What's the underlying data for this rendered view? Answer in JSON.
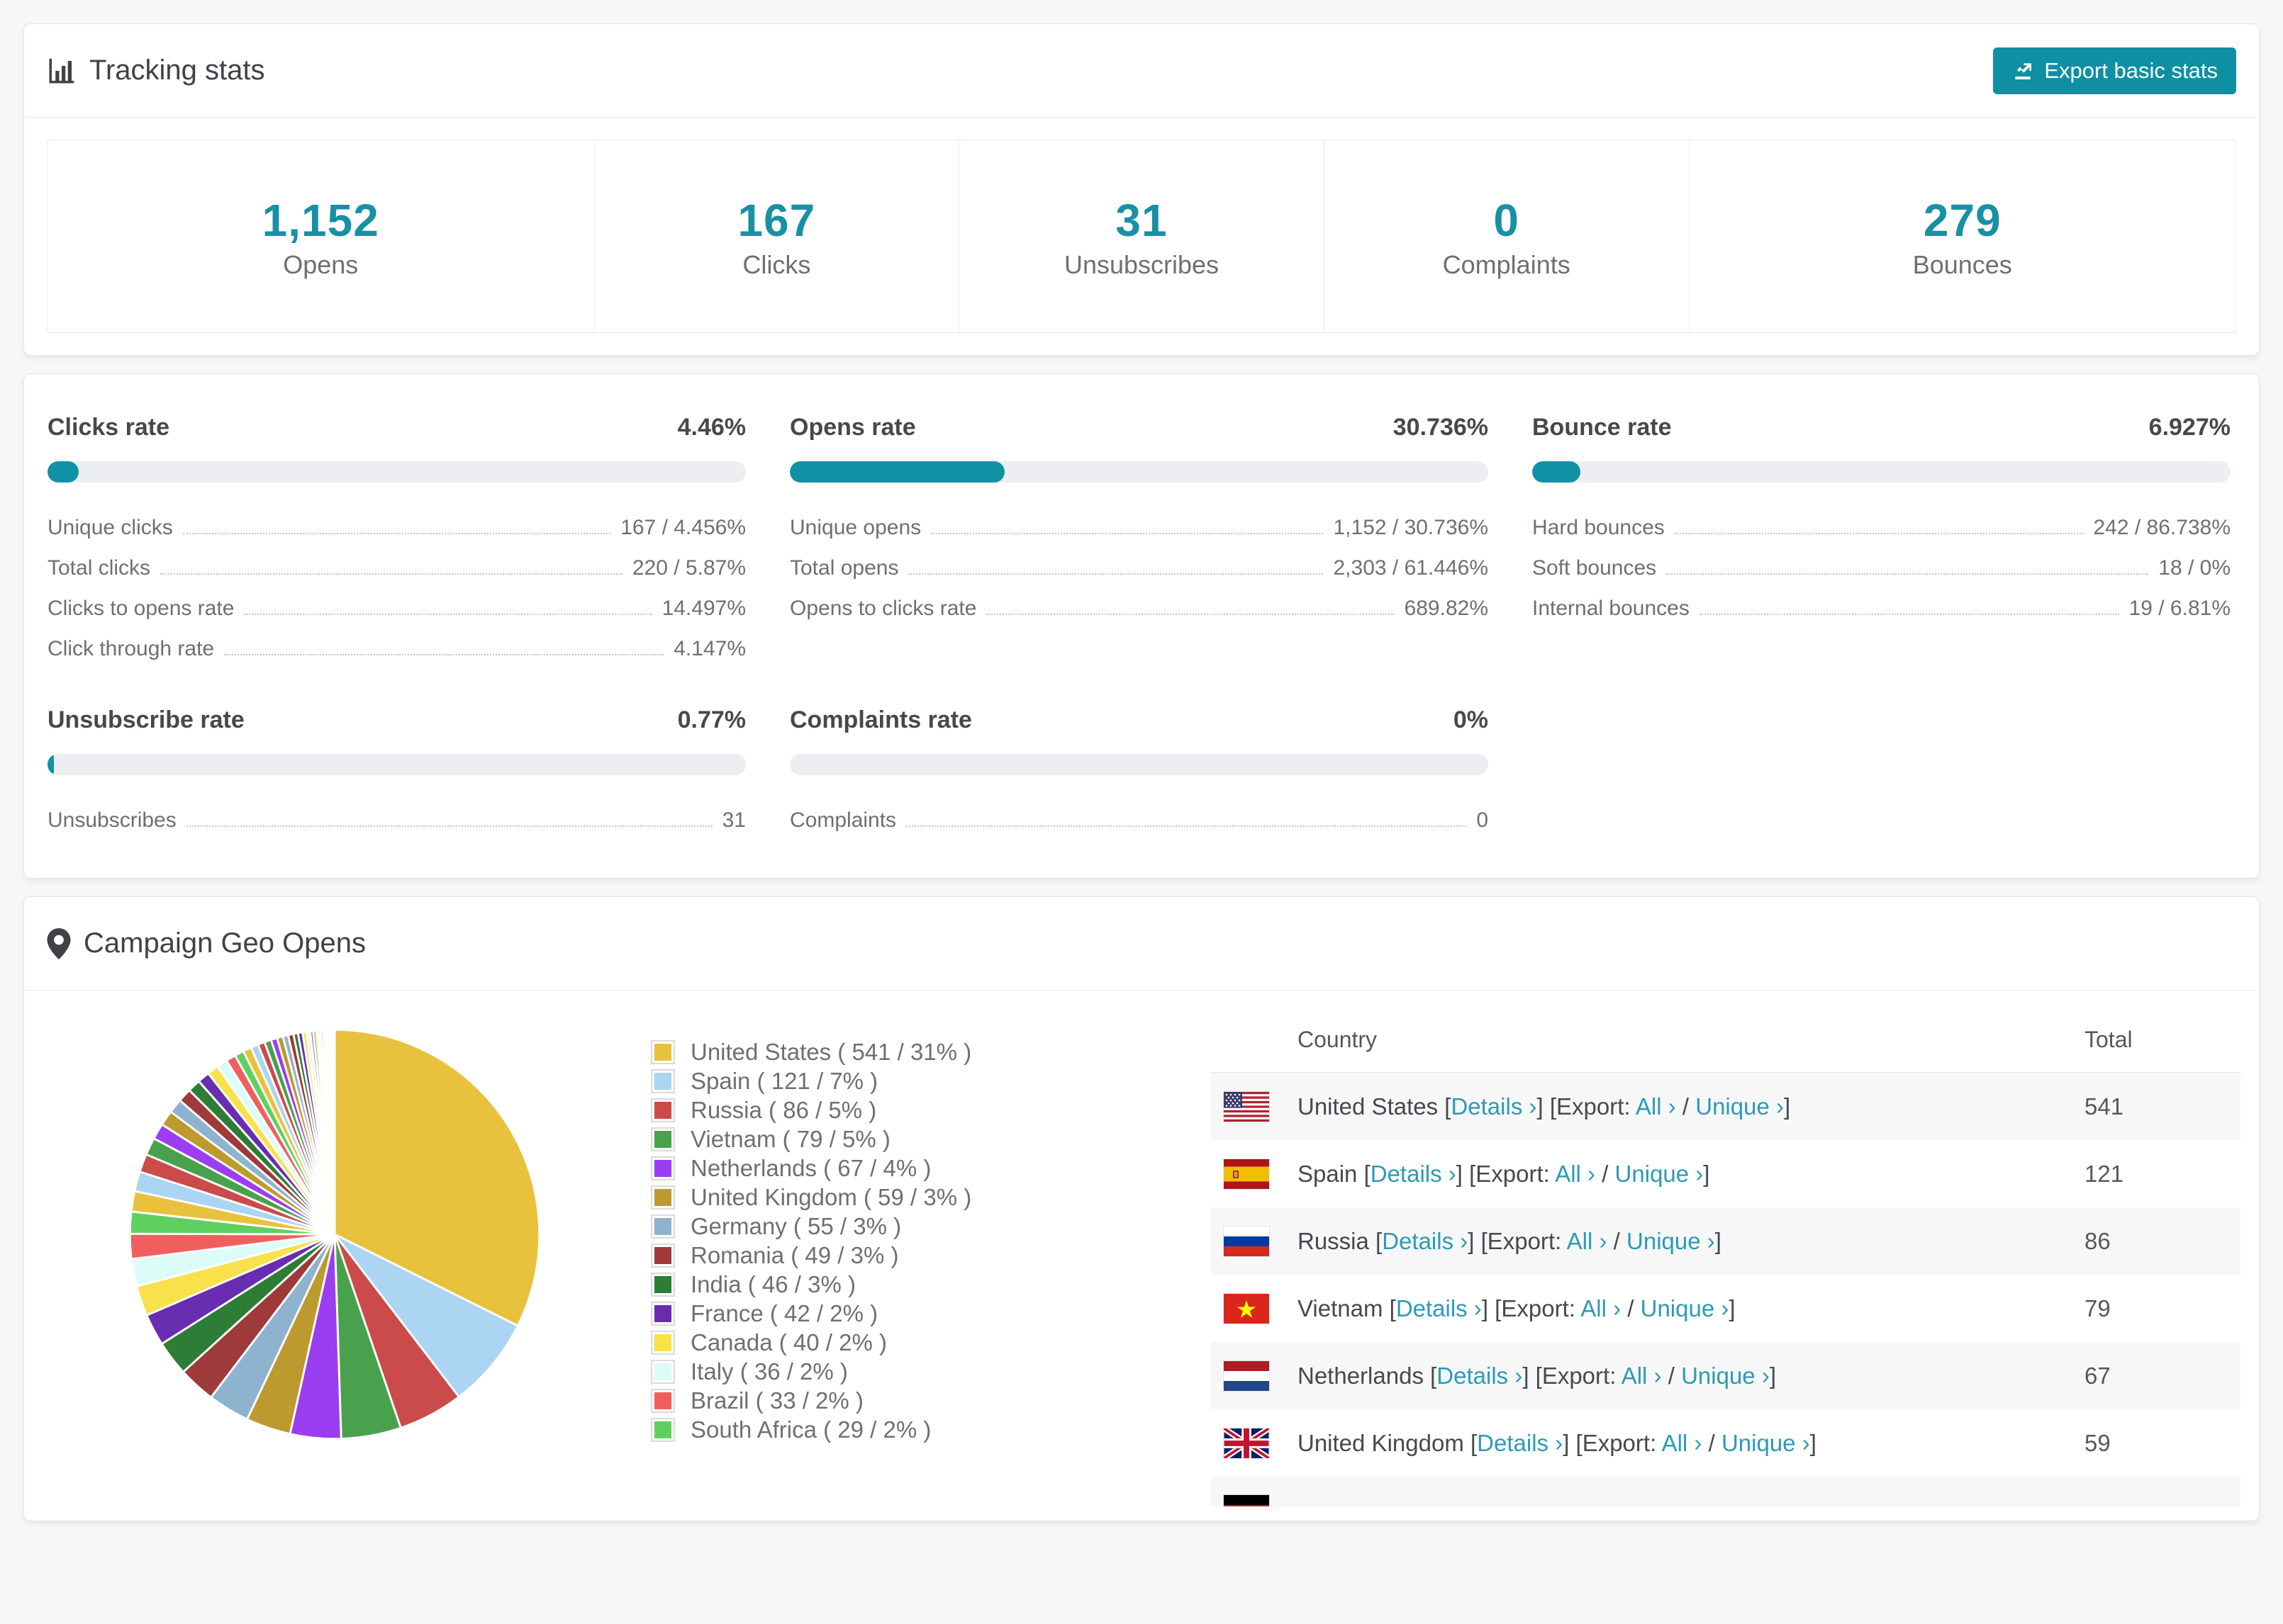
{
  "colors": {
    "accent": "#1791a5",
    "button": "#0e8fa4",
    "link": "#2d9ab8",
    "bar_track": "#eceef1",
    "row_stripe": "#f7f7f8"
  },
  "tracking": {
    "title": "Tracking stats",
    "export_button": "Export basic stats",
    "stats": [
      {
        "value": "1,152",
        "label": "Opens"
      },
      {
        "value": "167",
        "label": "Clicks"
      },
      {
        "value": "31",
        "label": "Unsubscribes"
      },
      {
        "value": "0",
        "label": "Complaints"
      },
      {
        "value": "279",
        "label": "Bounces"
      }
    ]
  },
  "rates": [
    {
      "title": "Clicks rate",
      "value": "4.46%",
      "bar_pct": 4.46,
      "rows": [
        {
          "label": "Unique clicks",
          "value": "167 / 4.456%"
        },
        {
          "label": "Total clicks",
          "value": "220 / 5.87%"
        },
        {
          "label": "Clicks to opens rate",
          "value": "14.497%"
        },
        {
          "label": "Click through rate",
          "value": "4.147%"
        }
      ]
    },
    {
      "title": "Opens rate",
      "value": "30.736%",
      "bar_pct": 30.736,
      "rows": [
        {
          "label": "Unique opens",
          "value": "1,152 / 30.736%"
        },
        {
          "label": "Total opens",
          "value": "2,303 / 61.446%"
        },
        {
          "label": "Opens to clicks rate",
          "value": "689.82%"
        }
      ]
    },
    {
      "title": "Bounce rate",
      "value": "6.927%",
      "bar_pct": 6.927,
      "rows": [
        {
          "label": "Hard bounces",
          "value": "242 / 86.738%"
        },
        {
          "label": "Soft bounces",
          "value": "18 / 0%"
        },
        {
          "label": "Internal bounces",
          "value": "19 / 6.81%"
        }
      ]
    },
    {
      "title": "Unsubscribe rate",
      "value": "0.77%",
      "bar_pct": 0.77,
      "rows": [
        {
          "label": "Unsubscribes",
          "value": "31"
        }
      ]
    },
    {
      "title": "Complaints rate",
      "value": "0%",
      "bar_pct": 0,
      "rows": [
        {
          "label": "Complaints",
          "value": "0"
        }
      ]
    }
  ],
  "geo": {
    "title": "Campaign Geo Opens",
    "links": {
      "details": "Details",
      "export": "Export:",
      "all": "All",
      "unique": "Unique",
      "chevron": "›"
    },
    "table": {
      "col_country": "Country",
      "col_total": "Total",
      "rows": [
        {
          "country": "United States",
          "flag": "us",
          "total": "541",
          "partial": false
        },
        {
          "country": "Spain",
          "flag": "es",
          "total": "121",
          "partial": false
        },
        {
          "country": "Russia",
          "flag": "ru",
          "total": "86",
          "partial": false
        },
        {
          "country": "Vietnam",
          "flag": "vn",
          "total": "79",
          "partial": false
        },
        {
          "country": "Netherlands",
          "flag": "nl",
          "total": "67",
          "partial": false
        },
        {
          "country": "United Kingdom",
          "flag": "gb",
          "total": "59",
          "partial": false
        },
        {
          "country": "",
          "flag": "de",
          "total": "",
          "partial": true
        }
      ]
    }
  },
  "chart_data": {
    "type": "pie",
    "title": "Campaign Geo Opens",
    "legend_position": "right",
    "series": [
      {
        "label": "United States",
        "value": 541,
        "pct": 31,
        "color": "#e9c23d"
      },
      {
        "label": "Spain",
        "value": 121,
        "pct": 7,
        "color": "#abd5f2"
      },
      {
        "label": "Russia",
        "value": 86,
        "pct": 5,
        "color": "#cb4a4a"
      },
      {
        "label": "Vietnam",
        "value": 79,
        "pct": 5,
        "color": "#49a14d"
      },
      {
        "label": "Netherlands",
        "value": 67,
        "pct": 4,
        "color": "#9b3df0"
      },
      {
        "label": "United Kingdom",
        "value": 59,
        "pct": 3,
        "color": "#bd9a2e"
      },
      {
        "label": "Germany",
        "value": 55,
        "pct": 3,
        "color": "#8eb3cf"
      },
      {
        "label": "Romania",
        "value": 49,
        "pct": 3,
        "color": "#9e3a3a"
      },
      {
        "label": "India",
        "value": 46,
        "pct": 3,
        "color": "#2e7d36"
      },
      {
        "label": "France",
        "value": 42,
        "pct": 2,
        "color": "#682db0"
      },
      {
        "label": "Canada",
        "value": 40,
        "pct": 2,
        "color": "#f8e14b"
      },
      {
        "label": "Italy",
        "value": 36,
        "pct": 2,
        "color": "#dcfcf7"
      },
      {
        "label": "Brazil",
        "value": 33,
        "pct": 2,
        "color": "#f05f5f"
      },
      {
        "label": "South Africa",
        "value": 29,
        "pct": 2,
        "color": "#5ed05f"
      }
    ],
    "others_values": [
      27,
      26,
      24,
      23,
      21,
      20,
      19,
      18,
      17,
      16,
      15,
      14,
      13,
      12,
      11,
      10,
      9,
      9,
      8,
      8,
      7,
      7,
      6,
      6,
      5,
      5,
      4,
      4,
      3,
      3,
      3,
      2,
      2,
      2,
      2,
      1,
      1,
      1,
      1,
      1,
      1,
      1
    ]
  }
}
